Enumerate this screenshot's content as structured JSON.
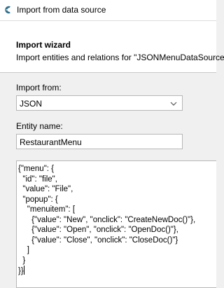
{
  "window": {
    "title": "Import from data source",
    "icon": "app-logo-icon"
  },
  "wizard": {
    "title": "Import wizard",
    "subtitle": "Import entities and relations for \"JSONMenuDataSource\""
  },
  "import_from": {
    "label": "Import from:",
    "value": "JSON",
    "icon": "chevron-down-icon"
  },
  "entity_name": {
    "label": "Entity name:",
    "value": "RestaurantMenu"
  },
  "editor": {
    "lines": [
      "{\"menu\": {",
      "  \"id\": \"file\",",
      "  \"value\": \"File\",",
      "  \"popup\": {",
      "    \"menuitem\": [",
      "      {\"value\": \"New\", \"onclick\": \"CreateNewDoc()\"},",
      "      {\"value\": \"Open\", \"onclick\": \"OpenDoc()\"},",
      "      {\"value\": \"Close\", \"onclick\": \"CloseDoc()\"}",
      "    ]",
      "  }",
      "}}"
    ]
  },
  "colors": {
    "accent": "#2d6e8a",
    "background": "#f0f0f0"
  }
}
